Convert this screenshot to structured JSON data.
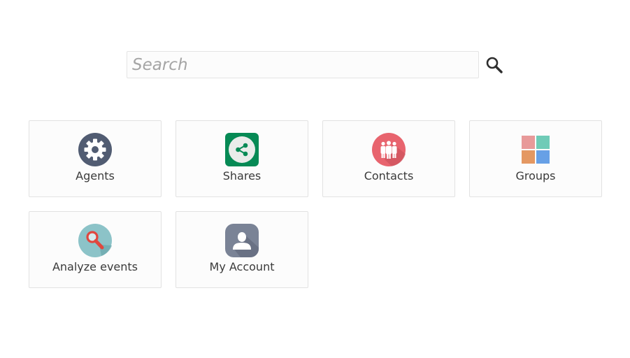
{
  "search": {
    "placeholder": "Search",
    "value": "",
    "icon": "search-icon"
  },
  "tiles": [
    {
      "label": "Agents",
      "icon": "gear-icon",
      "color": "#515c72"
    },
    {
      "label": "Shares",
      "icon": "share-icon",
      "color": "#068a55"
    },
    {
      "label": "Contacts",
      "icon": "people-icon",
      "color": "#e8646e"
    },
    {
      "label": "Groups",
      "icon": "grid-icon",
      "colors": [
        "#e89a9a",
        "#6fcbb7",
        "#e49862",
        "#67a0e6"
      ]
    },
    {
      "label": "Analyze events",
      "icon": "magnifier-icon",
      "color": "#8cc3c8"
    },
    {
      "label": "My Account",
      "icon": "user-icon",
      "color": "#7a8396"
    }
  ]
}
